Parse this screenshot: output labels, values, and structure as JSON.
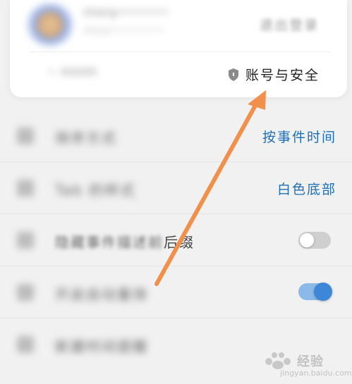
{
  "account": {
    "user_name": "zhang••••••••",
    "user_sub": "zhang•••••••••••",
    "logout_label": "退出登录",
    "edit_label": "修改资料",
    "security_label": "账号与安全"
  },
  "settings": {
    "rows": [
      {
        "label": "排序方式",
        "value": "按事件时间"
      },
      {
        "label": "Tab 的样式",
        "value": "白色底部"
      },
      {
        "label_blurred": "隐藏事件描述前",
        "label_clear": "后缀",
        "toggle": "off"
      },
      {
        "label": "开启自动重排",
        "toggle": "on"
      },
      {
        "label": "新建时间提醒"
      }
    ]
  },
  "annotation": {
    "color": "#f0904a"
  },
  "watermark": {
    "text": "经验",
    "url": "jingyan.baidu.com"
  }
}
